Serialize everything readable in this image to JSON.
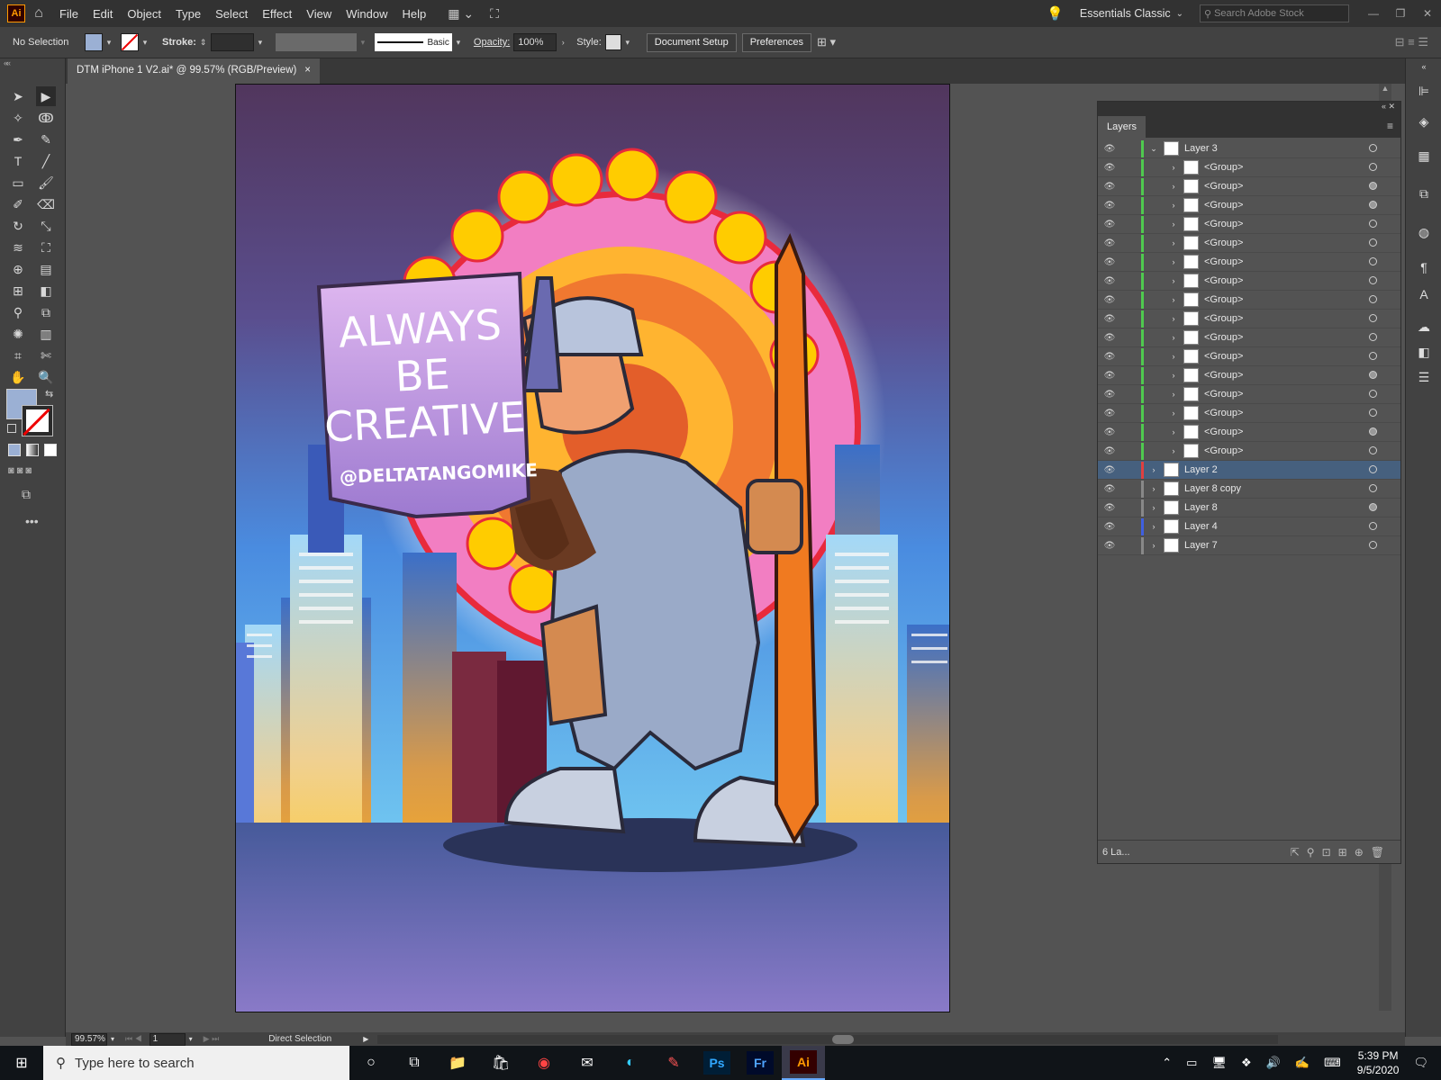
{
  "app": {
    "logo": "Ai",
    "workspace": "Essentials Classic",
    "search_placeholder": "Search Adobe Stock"
  },
  "menu": [
    "File",
    "Edit",
    "Object",
    "Type",
    "Select",
    "Effect",
    "View",
    "Window",
    "Help"
  ],
  "control": {
    "selection": "No Selection",
    "stroke_label": "Stroke:",
    "brush": "Basic",
    "opacity_label": "Opacity:",
    "opacity_value": "100%",
    "style_label": "Style:",
    "document_setup": "Document Setup",
    "preferences": "Preferences",
    "fill_color": "#9bb0d4"
  },
  "document": {
    "tab_title": "DTM iPhone 1 V2.ai* @ 99.57% (RGB/Preview)",
    "close": "×"
  },
  "artwork": {
    "sign_lines": [
      "ALWAYS",
      "BE",
      "CREATIVE"
    ],
    "handle": "@DELTATANGOMIKE"
  },
  "layers_panel": {
    "title": "Layers",
    "footer_count": "6 La...",
    "layers": [
      {
        "name": "Layer 3",
        "color": "#4fc94f",
        "expanded": true,
        "indent": 0,
        "target_filled": false
      },
      {
        "name": "<Group>",
        "color": "#4fc94f",
        "indent": 1,
        "target_filled": false
      },
      {
        "name": "<Group>",
        "color": "#4fc94f",
        "indent": 1,
        "target_filled": true
      },
      {
        "name": "<Group>",
        "color": "#4fc94f",
        "indent": 1,
        "target_filled": true
      },
      {
        "name": "<Group>",
        "color": "#4fc94f",
        "indent": 1,
        "target_filled": false
      },
      {
        "name": "<Group>",
        "color": "#4fc94f",
        "indent": 1,
        "target_filled": false
      },
      {
        "name": "<Group>",
        "color": "#4fc94f",
        "indent": 1,
        "target_filled": false
      },
      {
        "name": "<Group>",
        "color": "#4fc94f",
        "indent": 1,
        "target_filled": false
      },
      {
        "name": "<Group>",
        "color": "#4fc94f",
        "indent": 1,
        "target_filled": false
      },
      {
        "name": "<Group>",
        "color": "#4fc94f",
        "indent": 1,
        "target_filled": false
      },
      {
        "name": "<Group>",
        "color": "#4fc94f",
        "indent": 1,
        "target_filled": false
      },
      {
        "name": "<Group>",
        "color": "#4fc94f",
        "indent": 1,
        "target_filled": false
      },
      {
        "name": "<Group>",
        "color": "#4fc94f",
        "indent": 1,
        "target_filled": true
      },
      {
        "name": "<Group>",
        "color": "#4fc94f",
        "indent": 1,
        "target_filled": false
      },
      {
        "name": "<Group>",
        "color": "#4fc94f",
        "indent": 1,
        "target_filled": false
      },
      {
        "name": "<Group>",
        "color": "#4fc94f",
        "indent": 1,
        "target_filled": true
      },
      {
        "name": "<Group>",
        "color": "#4fc94f",
        "indent": 1,
        "target_filled": false
      },
      {
        "name": "Layer 2",
        "color": "#e04040",
        "indent": 0,
        "selected": true,
        "target_filled": false
      },
      {
        "name": "Layer 8 copy",
        "color": "#888888",
        "indent": 0,
        "target_filled": false
      },
      {
        "name": "Layer 8",
        "color": "#888888",
        "indent": 0,
        "target_filled": true
      },
      {
        "name": "Layer 4",
        "color": "#4060e0",
        "indent": 0,
        "target_filled": false
      },
      {
        "name": "Layer 7",
        "color": "#888888",
        "indent": 0,
        "target_filled": false
      }
    ]
  },
  "status": {
    "zoom": "99.57%",
    "artboard": "1",
    "tool": "Direct Selection"
  },
  "taskbar": {
    "search": "Type here to search",
    "time": "5:39 PM",
    "date": "9/5/2020",
    "apps": [
      "Ps",
      "Fr",
      "Ai"
    ]
  }
}
